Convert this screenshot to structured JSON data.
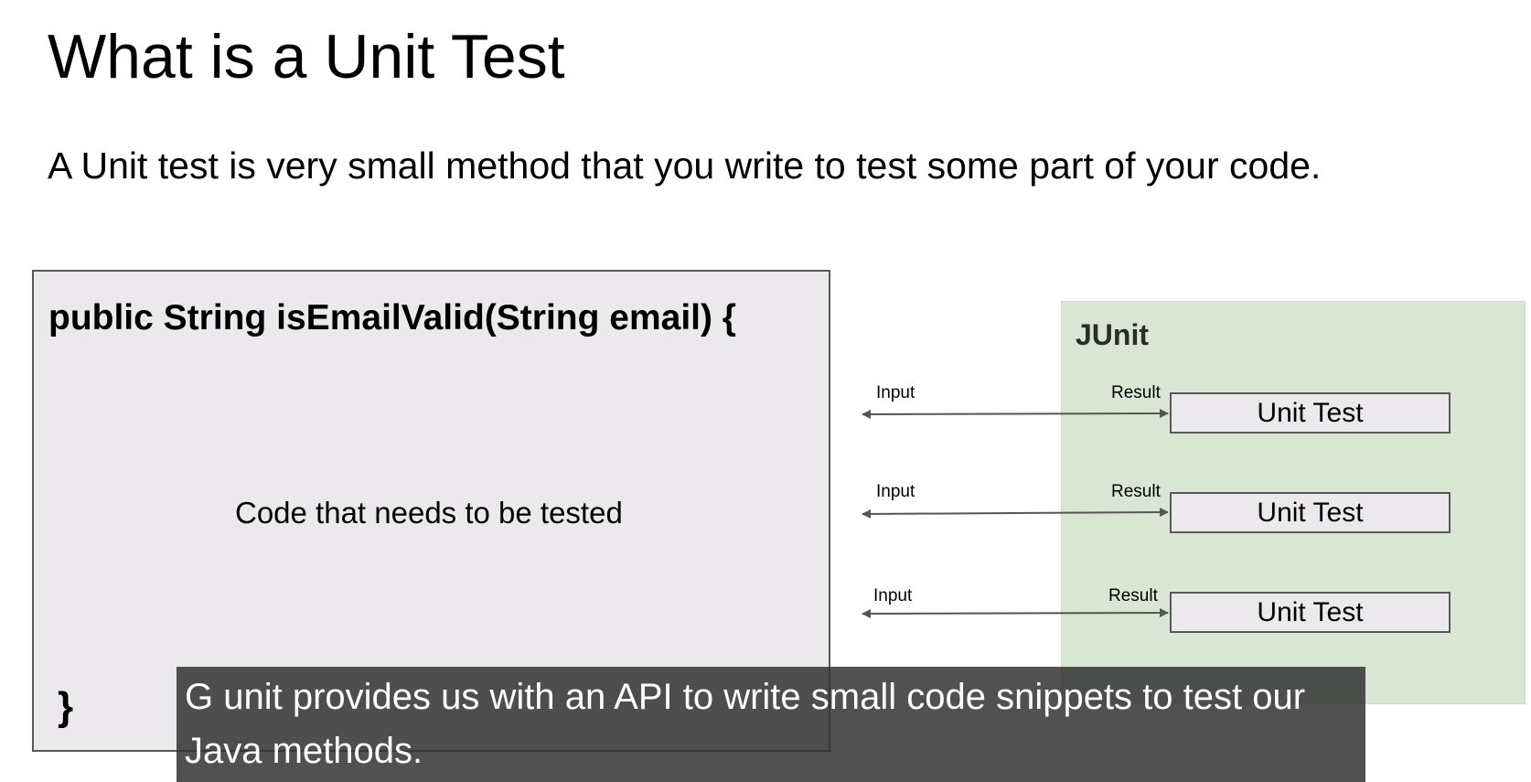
{
  "slide": {
    "title": "What is a Unit Test",
    "subtitle": "A Unit test is very small method that you write to test some part of your code."
  },
  "code_box": {
    "signature": "public String isEmailValid(String email) {",
    "body": "Code that needs to be tested",
    "closing_brace": "}"
  },
  "junit": {
    "label": "JUnit",
    "tests": [
      {
        "input_label": "Input",
        "result_label": "Result",
        "name": "Unit Test"
      },
      {
        "input_label": "Input",
        "result_label": "Result",
        "name": "Unit Test"
      },
      {
        "input_label": "Input",
        "result_label": "Result",
        "name": "Unit Test"
      }
    ]
  },
  "caption": {
    "text": "G unit provides us with an API to write small code snippets to test our Java methods."
  },
  "colors": {
    "code_box_bg": "#ebe9ec",
    "junit_bg": "#d9e6d3",
    "arrow": "#555555",
    "caption_bg": "#333333"
  }
}
